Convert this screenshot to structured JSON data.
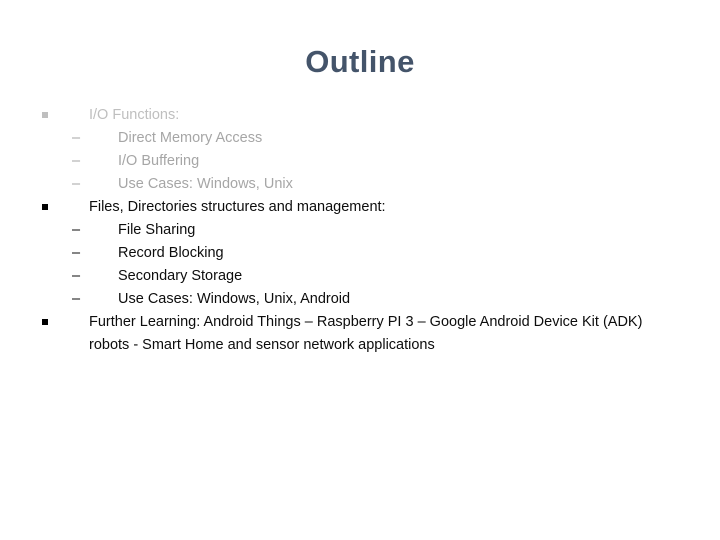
{
  "slide": {
    "title": "Outline",
    "title_color": "#44546a",
    "background_color": "#ffffff"
  },
  "colors": {
    "group1_level1_text": "#bfbfbf",
    "group1_level2_text": "#a6a6a6",
    "group2_text": "#0d0d0d",
    "group3_text": "#0d0d0d",
    "bullet_light": "#bfbfbf",
    "bullet_dark": "#000000"
  },
  "content": {
    "groups": [
      {
        "heading": "I/O Functions:",
        "bullet_glyph": "square",
        "items": [
          {
            "dash": "–",
            "text": "Direct Memory Access"
          },
          {
            "dash": "–",
            "text": "I/O Buffering"
          },
          {
            "dash": "–",
            "text": "Use Cases: Windows, Unix"
          }
        ]
      },
      {
        "heading": "Files, Directories structures and management:",
        "bullet_glyph": "square",
        "items": [
          {
            "dash": "–",
            "text": "File Sharing"
          },
          {
            "dash": "–",
            "text": "Record Blocking"
          },
          {
            "dash": "–",
            "text": "Secondary Storage"
          },
          {
            "dash": "–",
            "text": "Use Cases: Windows, Unix, Android"
          }
        ]
      },
      {
        "heading": "Further Learning: Android Things – Raspberry PI 3 – Google Android Device Kit (ADK) robots  - Smart Home and sensor network applications",
        "bullet_glyph": "square",
        "items": []
      }
    ]
  }
}
